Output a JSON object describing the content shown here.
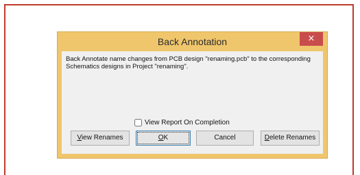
{
  "dialog": {
    "title": "Back Annotation",
    "close_label": "×",
    "message": "Back Annotate name changes from PCB design \"renaming.pcb\" to the corresponding Schematics designs in Project \"renaming\".",
    "report_checkbox_label": "View Report On Completion",
    "report_checkbox_checked": false,
    "buttons": {
      "view_renames": {
        "mnemonic": "V",
        "rest": "iew Renames"
      },
      "ok": {
        "mnemonic": "O",
        "rest": "K"
      },
      "cancel": "Cancel",
      "delete_renames": {
        "mnemonic": "D",
        "rest": "elete Renames"
      }
    }
  },
  "colors": {
    "dialog_frame": "#f0c66c",
    "close_button": "#c94c4c",
    "outer_border": "#c0392b"
  }
}
